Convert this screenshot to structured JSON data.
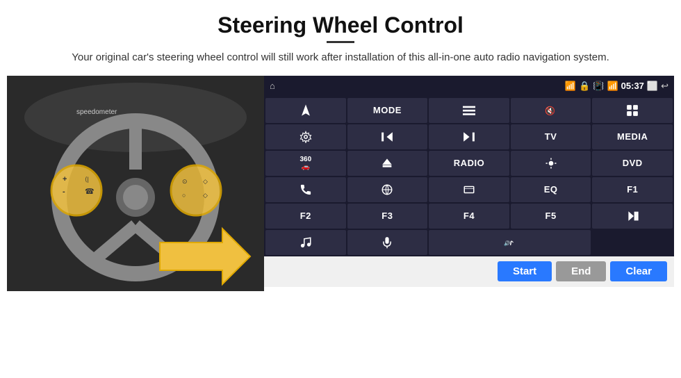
{
  "header": {
    "title": "Steering Wheel Control",
    "subtitle": "Your original car's steering wheel control will still work after installation of this all-in-one auto radio navigation system."
  },
  "statusBar": {
    "time": "05:37",
    "icons": [
      "wifi",
      "lock",
      "sim",
      "bluetooth",
      "screen",
      "back"
    ]
  },
  "buttons": [
    {
      "id": "nav",
      "type": "icon",
      "icon": "navigate"
    },
    {
      "id": "mode",
      "type": "text",
      "label": "MODE"
    },
    {
      "id": "menu",
      "type": "icon",
      "icon": "menu"
    },
    {
      "id": "mute",
      "type": "icon",
      "icon": "mute"
    },
    {
      "id": "apps",
      "type": "icon",
      "icon": "apps"
    },
    {
      "id": "settings",
      "type": "icon",
      "icon": "settings"
    },
    {
      "id": "prev",
      "type": "icon",
      "icon": "prev"
    },
    {
      "id": "next",
      "type": "icon",
      "icon": "next"
    },
    {
      "id": "tv",
      "type": "text",
      "label": "TV"
    },
    {
      "id": "media",
      "type": "text",
      "label": "MEDIA"
    },
    {
      "id": "cam360",
      "type": "icon",
      "icon": "360cam"
    },
    {
      "id": "eject",
      "type": "icon",
      "icon": "eject"
    },
    {
      "id": "radio",
      "type": "text",
      "label": "RADIO"
    },
    {
      "id": "brightness",
      "type": "icon",
      "icon": "brightness"
    },
    {
      "id": "dvd",
      "type": "text",
      "label": "DVD"
    },
    {
      "id": "phone",
      "type": "icon",
      "icon": "phone"
    },
    {
      "id": "browser",
      "type": "icon",
      "icon": "browser"
    },
    {
      "id": "screen_ratio",
      "type": "icon",
      "icon": "screen_ratio"
    },
    {
      "id": "eq",
      "type": "text",
      "label": "EQ"
    },
    {
      "id": "f1",
      "type": "text",
      "label": "F1"
    },
    {
      "id": "f2",
      "type": "text",
      "label": "F2"
    },
    {
      "id": "f3",
      "type": "text",
      "label": "F3"
    },
    {
      "id": "f4",
      "type": "text",
      "label": "F4"
    },
    {
      "id": "f5",
      "type": "text",
      "label": "F5"
    },
    {
      "id": "playpause",
      "type": "icon",
      "icon": "playpause"
    },
    {
      "id": "music",
      "type": "icon",
      "icon": "music"
    },
    {
      "id": "mic",
      "type": "icon",
      "icon": "mic"
    },
    {
      "id": "vol_call",
      "type": "icon",
      "icon": "vol_call"
    }
  ],
  "bottomBar": {
    "startLabel": "Start",
    "endLabel": "End",
    "clearLabel": "Clear"
  }
}
